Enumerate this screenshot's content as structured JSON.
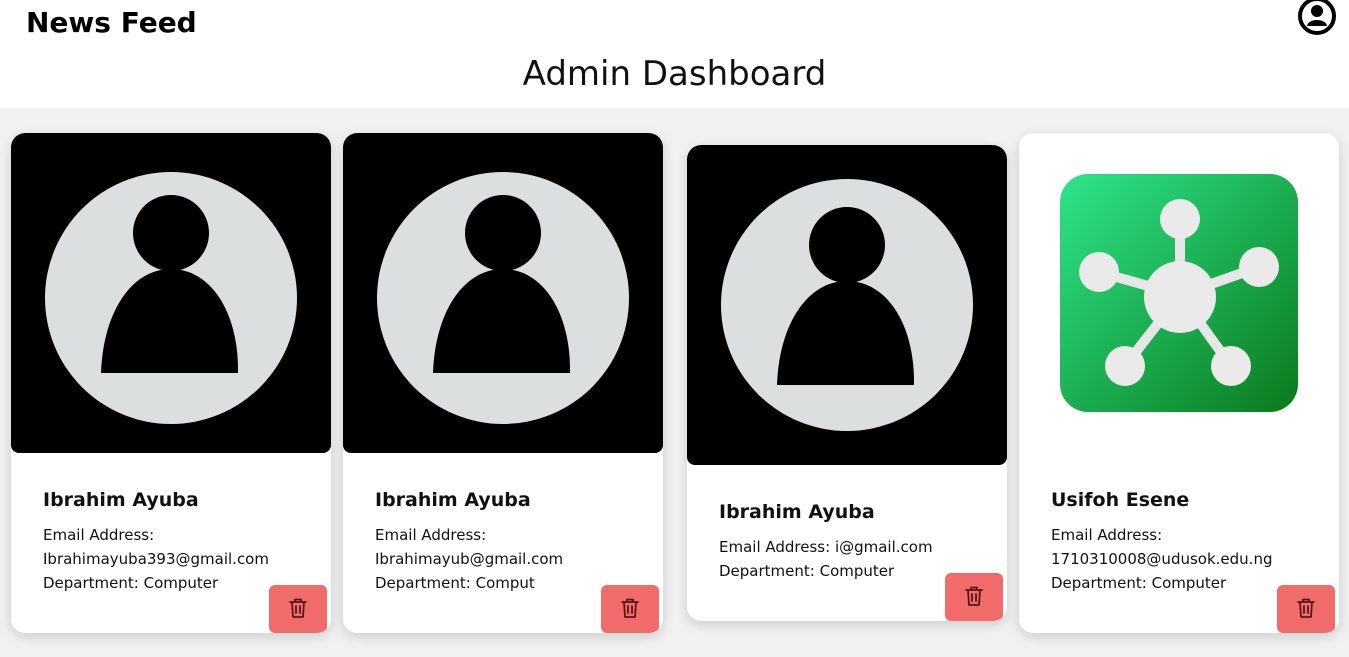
{
  "header": {
    "brand": "News Feed",
    "account_icon": "user-circle-icon"
  },
  "page": {
    "title": "Admin Dashboard"
  },
  "colors": {
    "delete_button": "#f26b6b",
    "content_background": "#f1f1f1",
    "avatar_circle": "#dcdfdf"
  },
  "users": [
    {
      "name": "Ibrahim Ayuba",
      "email_label": "Email Address:",
      "email": "Ibrahimayuba393@gmail.com",
      "department": "Department: Computer",
      "image": "default-avatar",
      "delete_icon": "trash-icon"
    },
    {
      "name": "Ibrahim Ayuba",
      "email_label": "Email Address:",
      "email": "Ibrahimayub@gmail.com",
      "department": "Department: Comput",
      "image": "default-avatar",
      "delete_icon": "trash-icon"
    },
    {
      "name": "Ibrahim Ayuba",
      "email_line": "Email Address: i@gmail.com",
      "department": "Department: Computer",
      "image": "default-avatar",
      "delete_icon": "trash-icon"
    },
    {
      "name": "Usifoh Esene",
      "email_label": "Email Address:",
      "email": "1710310008@udusok.edu.ng",
      "department": "Department: Computer",
      "image": "network-app-icon",
      "delete_icon": "trash-icon"
    }
  ]
}
